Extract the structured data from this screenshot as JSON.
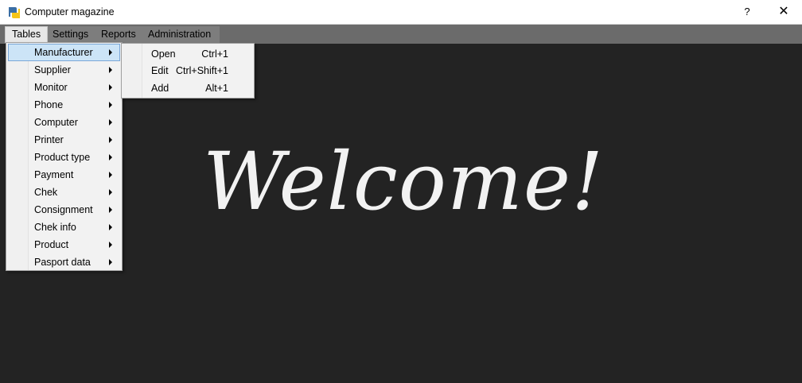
{
  "window": {
    "title": "Computer magazine",
    "help_label": "?",
    "close_label": "✕",
    "icon": "python-icon"
  },
  "menubar": {
    "items": [
      {
        "label": "Tables"
      },
      {
        "label": "Settings"
      },
      {
        "label": "Reports"
      },
      {
        "label": "Administration"
      }
    ],
    "active_index": 0
  },
  "tables_menu": {
    "items": [
      {
        "label": "Manufacturer"
      },
      {
        "label": "Supplier"
      },
      {
        "label": "Monitor"
      },
      {
        "label": "Phone"
      },
      {
        "label": "Computer"
      },
      {
        "label": "Printer"
      },
      {
        "label": "Product type"
      },
      {
        "label": "Payment"
      },
      {
        "label": "Chek"
      },
      {
        "label": "Consignment"
      },
      {
        "label": "Chek info"
      },
      {
        "label": "Product"
      },
      {
        "label": "Pasport data"
      }
    ],
    "highlighted_index": 0
  },
  "submenu": {
    "items": [
      {
        "label": "Open",
        "shortcut": "Ctrl+1"
      },
      {
        "label": "Edit",
        "shortcut": "Ctrl+Shift+1"
      },
      {
        "label": "Add",
        "shortcut": "Alt+1"
      }
    ]
  },
  "main": {
    "welcome_text": "Welcome!"
  },
  "colors": {
    "background": "#232323",
    "menubar": "#6b6b6b",
    "highlight": "#cce4f7",
    "highlight_border": "#7aa7d8",
    "welcome_text": "#f2f2f2"
  }
}
